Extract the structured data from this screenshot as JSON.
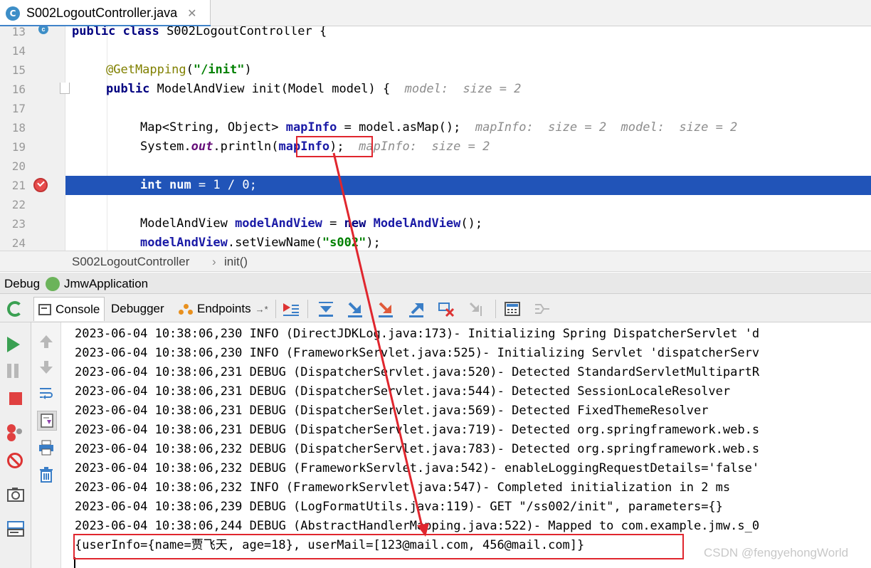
{
  "tab": {
    "label": "S002LogoutController.java",
    "close": "✕",
    "icon_letter": "C"
  },
  "editor": {
    "lines": [
      {
        "num": "13",
        "text": "public class S002LogoutController {"
      },
      {
        "num": "14",
        "text": ""
      },
      {
        "num": "15",
        "text": "@GetMapping(\"/init\")"
      },
      {
        "num": "16",
        "text": "public ModelAndView init(Model model) {",
        "hint": "model:  size = 2"
      },
      {
        "num": "17",
        "text": ""
      },
      {
        "num": "18",
        "text": "Map<String, Object> mapInfo = model.asMap();",
        "hint": "mapInfo:  size = 2  model:  size = 2"
      },
      {
        "num": "19",
        "text": "System.out.println(mapInfo);",
        "hint": "mapInfo:  size = 2"
      },
      {
        "num": "20",
        "text": ""
      },
      {
        "num": "21",
        "text": "int num = 1 / 0;"
      },
      {
        "num": "22",
        "text": ""
      },
      {
        "num": "23",
        "text": "ModelAndView modelAndView = new ModelAndView();"
      },
      {
        "num": "24",
        "text": "modelAndView.setViewName(\"s002\");"
      }
    ]
  },
  "breadcrumb": {
    "class_name": "S002LogoutController",
    "separator": "›",
    "method": "init()"
  },
  "debug": {
    "label": "Debug",
    "app": "JmwApplication"
  },
  "toolbar": {
    "console": "Console",
    "debugger": "Debugger",
    "endpoints": "Endpoints",
    "endpoints_arrow": "→*"
  },
  "console": {
    "lines": [
      "2023-06-04 10:38:06,230 INFO (DirectJDKLog.java:173)- Initializing Spring DispatcherServlet 'd",
      "2023-06-04 10:38:06,230 INFO (FrameworkServlet.java:525)- Initializing Servlet 'dispatcherServ",
      "2023-06-04 10:38:06,231 DEBUG (DispatcherServlet.java:520)- Detected StandardServletMultipartR",
      "2023-06-04 10:38:06,231 DEBUG (DispatcherServlet.java:544)- Detected SessionLocaleResolver",
      "2023-06-04 10:38:06,231 DEBUG (DispatcherServlet.java:569)- Detected FixedThemeResolver",
      "2023-06-04 10:38:06,231 DEBUG (DispatcherServlet.java:719)- Detected org.springframework.web.s",
      "2023-06-04 10:38:06,232 DEBUG (DispatcherServlet.java:783)- Detected org.springframework.web.s",
      "2023-06-04 10:38:06,232 DEBUG (FrameworkServlet.java:542)- enableLoggingRequestDetails='false'",
      "2023-06-04 10:38:06,232 INFO (FrameworkServlet.java:547)- Completed initialization in 2 ms",
      "2023-06-04 10:38:06,239 DEBUG (LogFormatUtils.java:119)- GET \"/ss002/init\", parameters={}",
      "2023-06-04 10:38:06,244 DEBUG (AbstractHandlerMapping.java:522)- Mapped to com.example.jmw.s_0",
      "{userInfo={name=贾飞天, age=18}, userMail=[123@mail.com, 456@mail.com]}"
    ]
  },
  "watermark": "CSDN @fengyehongWorld",
  "colors": {
    "highlight": "#2154b8",
    "annotation_red": "#e0262e",
    "tab_accent": "#4083c9"
  }
}
